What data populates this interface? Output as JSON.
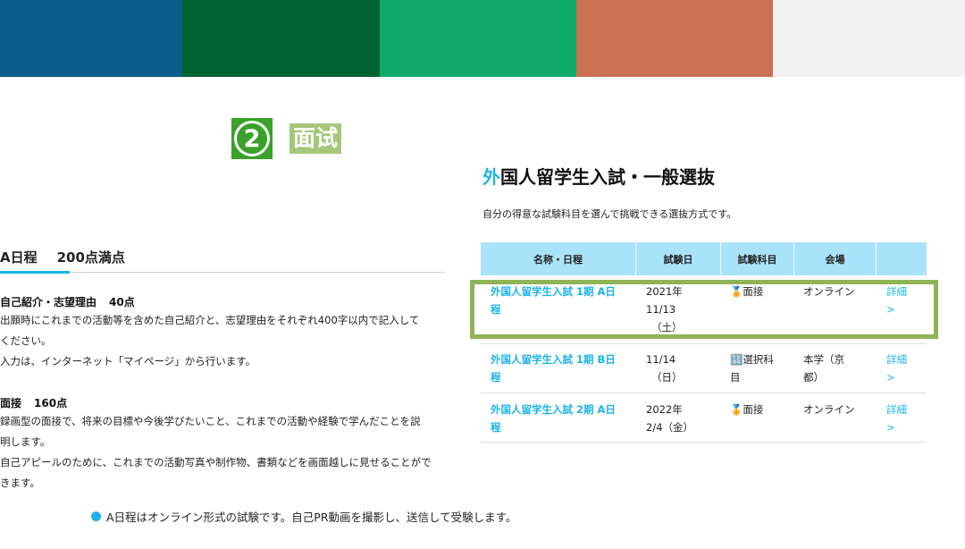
{
  "swatches": [
    "#0a5d8c",
    "#006131",
    "#0faa6a",
    "#c97152",
    "#f2f2f2"
  ],
  "step": {
    "number": "2",
    "badge_color": "#3aa12a",
    "title": "面试",
    "title_bg": "#a6c77a"
  },
  "left": {
    "heading_a": "A日程",
    "heading_b": "200点満点",
    "section1_title": "自己紹介・志望理由",
    "section1_points": "40点",
    "section1_lines": [
      "出願時にこれまでの活動等を含めた自己紹介と、志望理由をそれぞれ400字以内で記入して",
      "ください。",
      "入力は、インターネット「マイページ」から行います。"
    ],
    "section2_title": "面接",
    "section2_points": "160点",
    "section2_lines": [
      "録画型の面接で、将来の目標や今後学びたいこと、これまでの活動や経験で学んだことを説",
      "明します。",
      "自己アピールのために、これまでの活動写真や制作物、書類などを画面越しに見せることがで",
      "きます。"
    ],
    "note": "A日程はオンライン形式の試験です。自己PR動画を撮影し、送信して受験します。"
  },
  "right": {
    "title_first": "外",
    "title_rest": "国人留学生入試・一般選抜",
    "description": "自分の得意な試験科目を選んで挑戦できる選抜方式です。",
    "table": {
      "headers": [
        "名称・日程",
        "試験日",
        "試験科目",
        "会場",
        ""
      ],
      "rows": [
        {
          "name": [
            "外国人留学生入試 1期 A日",
            "程"
          ],
          "date": [
            "2021年",
            "11/13",
            "（土）"
          ],
          "subject": [
            "🏅面接"
          ],
          "venue": [
            "オンライン"
          ],
          "detail": [
            "詳細",
            ">"
          ]
        },
        {
          "name": [
            "外国人留学生入試 1期 B日",
            "程"
          ],
          "date": [
            "11/14",
            "（日）"
          ],
          "subject": [
            "🔢選択科",
            "目"
          ],
          "venue": [
            "本学（京",
            "都）"
          ],
          "detail": [
            "詳細",
            ">"
          ]
        },
        {
          "name": [
            "外国人留学生入試 2期 A日",
            "程"
          ],
          "date": [
            "2022年",
            "2/4（金）"
          ],
          "subject": [
            "🏅面接"
          ],
          "venue": [
            "オンライン"
          ],
          "detail": [
            "詳細",
            ">"
          ]
        }
      ]
    }
  },
  "colors": {
    "accent_blue": "#1bb3e8",
    "header_bg": "#a9e3fa",
    "highlight_border": "#8fb356"
  }
}
